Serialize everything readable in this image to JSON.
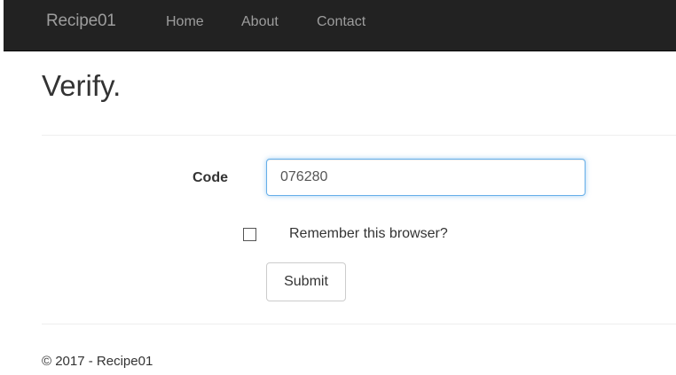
{
  "navbar": {
    "brand": "Recipe01",
    "links": [
      "Home",
      "About",
      "Contact"
    ]
  },
  "page": {
    "title": "Verify."
  },
  "form": {
    "code_label": "Code",
    "code_value": "076280",
    "remember_label": "Remember this browser?",
    "remember_checked": false,
    "submit_label": "Submit"
  },
  "footer": {
    "copyright": "© 2017 - Recipe01"
  },
  "colors": {
    "navbar_bg": "#222222",
    "navbar_text": "#9d9d9d",
    "input_focus_border": "#66afe9",
    "divider": "#eeeeee"
  }
}
